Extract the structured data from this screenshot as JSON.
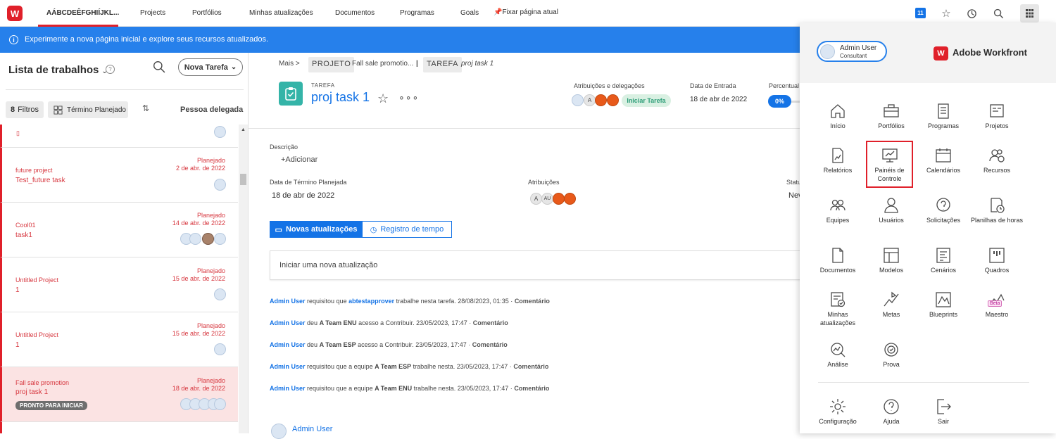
{
  "topnav": {
    "items": [
      "AÁBCDEÊFGHIÍJKL...",
      "Projects",
      "Portfólios",
      "Minhas atualizações",
      "Documentos",
      "Programas",
      "Goals",
      "Fixar página atual"
    ],
    "notification_count": "11"
  },
  "banner": {
    "text": "Experimente a nova página inicial e explore seus recursos atualizados."
  },
  "left": {
    "title": "Lista de trabalhos",
    "new_task": "Nova Tarefa",
    "filters_count": "8",
    "filters_label": "Filtros",
    "sort_label": "Término Planejado",
    "column": "Pessoa delegada",
    "rows": [
      {
        "project": "",
        "task": "",
        "status": "",
        "date": ""
      },
      {
        "project": "future project",
        "task": "Test_future task",
        "status": "Planejado",
        "date": "2 de abr. de 2022"
      },
      {
        "project": "Cool01",
        "task": "task1",
        "status": "Planejado",
        "date": "14 de abr. de 2022"
      },
      {
        "project": "Untitled Project",
        "task": "1",
        "status": "Planejado",
        "date": "15 de abr. de 2022"
      },
      {
        "project": "Untitled Project",
        "task": "1",
        "status": "Planejado",
        "date": "15 de abr. de 2022"
      },
      {
        "project": "Fall sale promotion",
        "task": "proj task 1",
        "status": "Planejado",
        "date": "18 de abr. de 2022",
        "badge": "PRONTO PARA INICIAR"
      }
    ]
  },
  "main": {
    "breadcrumb": {
      "mais": "Mais >",
      "projeto_tag": "PROJETO",
      "projeto": "Fall sale promotio...",
      "sep": "|",
      "tarefa_tag": "TAREFA",
      "tarefa": "proj task 1"
    },
    "kind": "TAREFA",
    "task_name": "proj task 1",
    "assign_label": "Atribuições e delegações",
    "start_btn": "Iniciar Tarefa",
    "entry_label": "Data de Entrada",
    "entry_value": "18 de abr de 2022",
    "percent_label": "Percentual c",
    "percent_value": "0%",
    "desc_label": "Descrição",
    "add_label": "+Adicionar",
    "end_label": "Data de Término Planejada",
    "end_value": "18 de abr de 2022",
    "attrib_label": "Atribuições",
    "status_label": "Status",
    "status_value": "Nev",
    "tab_updates": "Novas atualizações",
    "tab_time": "Registro de tempo",
    "new_update": "Iniciar uma nova atualização",
    "feed": [
      {
        "user": "Admin User",
        "pre": "requisitou que",
        "link": "abtestapprover",
        "mid": "trabalhe nesta tarefa.",
        "bold2": "",
        "post": "",
        "time": "28/08/2023, 01:35 ·",
        "action": "Comentário"
      },
      {
        "user": "Admin User",
        "pre": "deu",
        "link": "",
        "mid": "",
        "bold2": "A Team ENU",
        "post": "acesso a Contribuir.",
        "time": "23/05/2023, 17:47 ·",
        "action": "Comentário"
      },
      {
        "user": "Admin User",
        "pre": "deu",
        "link": "",
        "mid": "",
        "bold2": "A Team ESP",
        "post": "acesso a Contribuir.",
        "time": "23/05/2023, 17:47 ·",
        "action": "Comentário"
      },
      {
        "user": "Admin User",
        "pre": "requisitou que a equipe",
        "link": "",
        "mid": "",
        "bold2": "A Team ESP",
        "post": "trabalhe nesta.",
        "time": "23/05/2023, 17:47 ·",
        "action": "Comentário"
      },
      {
        "user": "Admin User",
        "pre": "requisitou que a equipe",
        "link": "",
        "mid": "",
        "bold2": "A Team ENU",
        "post": "trabalhe nesta.",
        "time": "23/05/2023, 17:47 ·",
        "action": "Comentário"
      }
    ],
    "bottom_user": "Admin User"
  },
  "panel": {
    "user_name": "Admin User",
    "user_role": "Consultant",
    "brand": "Adobe Workfront",
    "apps": [
      "Início",
      "Portfólios",
      "Programas",
      "Projetos",
      "Relatórios",
      "Painéis de Controle",
      "Calendários",
      "Recursos",
      "Equipes",
      "Usuários",
      "Solicitações",
      "Planilhas de horas",
      "Documentos",
      "Modelos",
      "Cenários",
      "Quadros",
      "Minhas atualizações",
      "Metas",
      "Blueprints",
      "Maestro",
      "Análise",
      "Prova"
    ],
    "beta": "Beta",
    "footer": [
      "Configuração",
      "Ajuda",
      "Sair"
    ]
  }
}
